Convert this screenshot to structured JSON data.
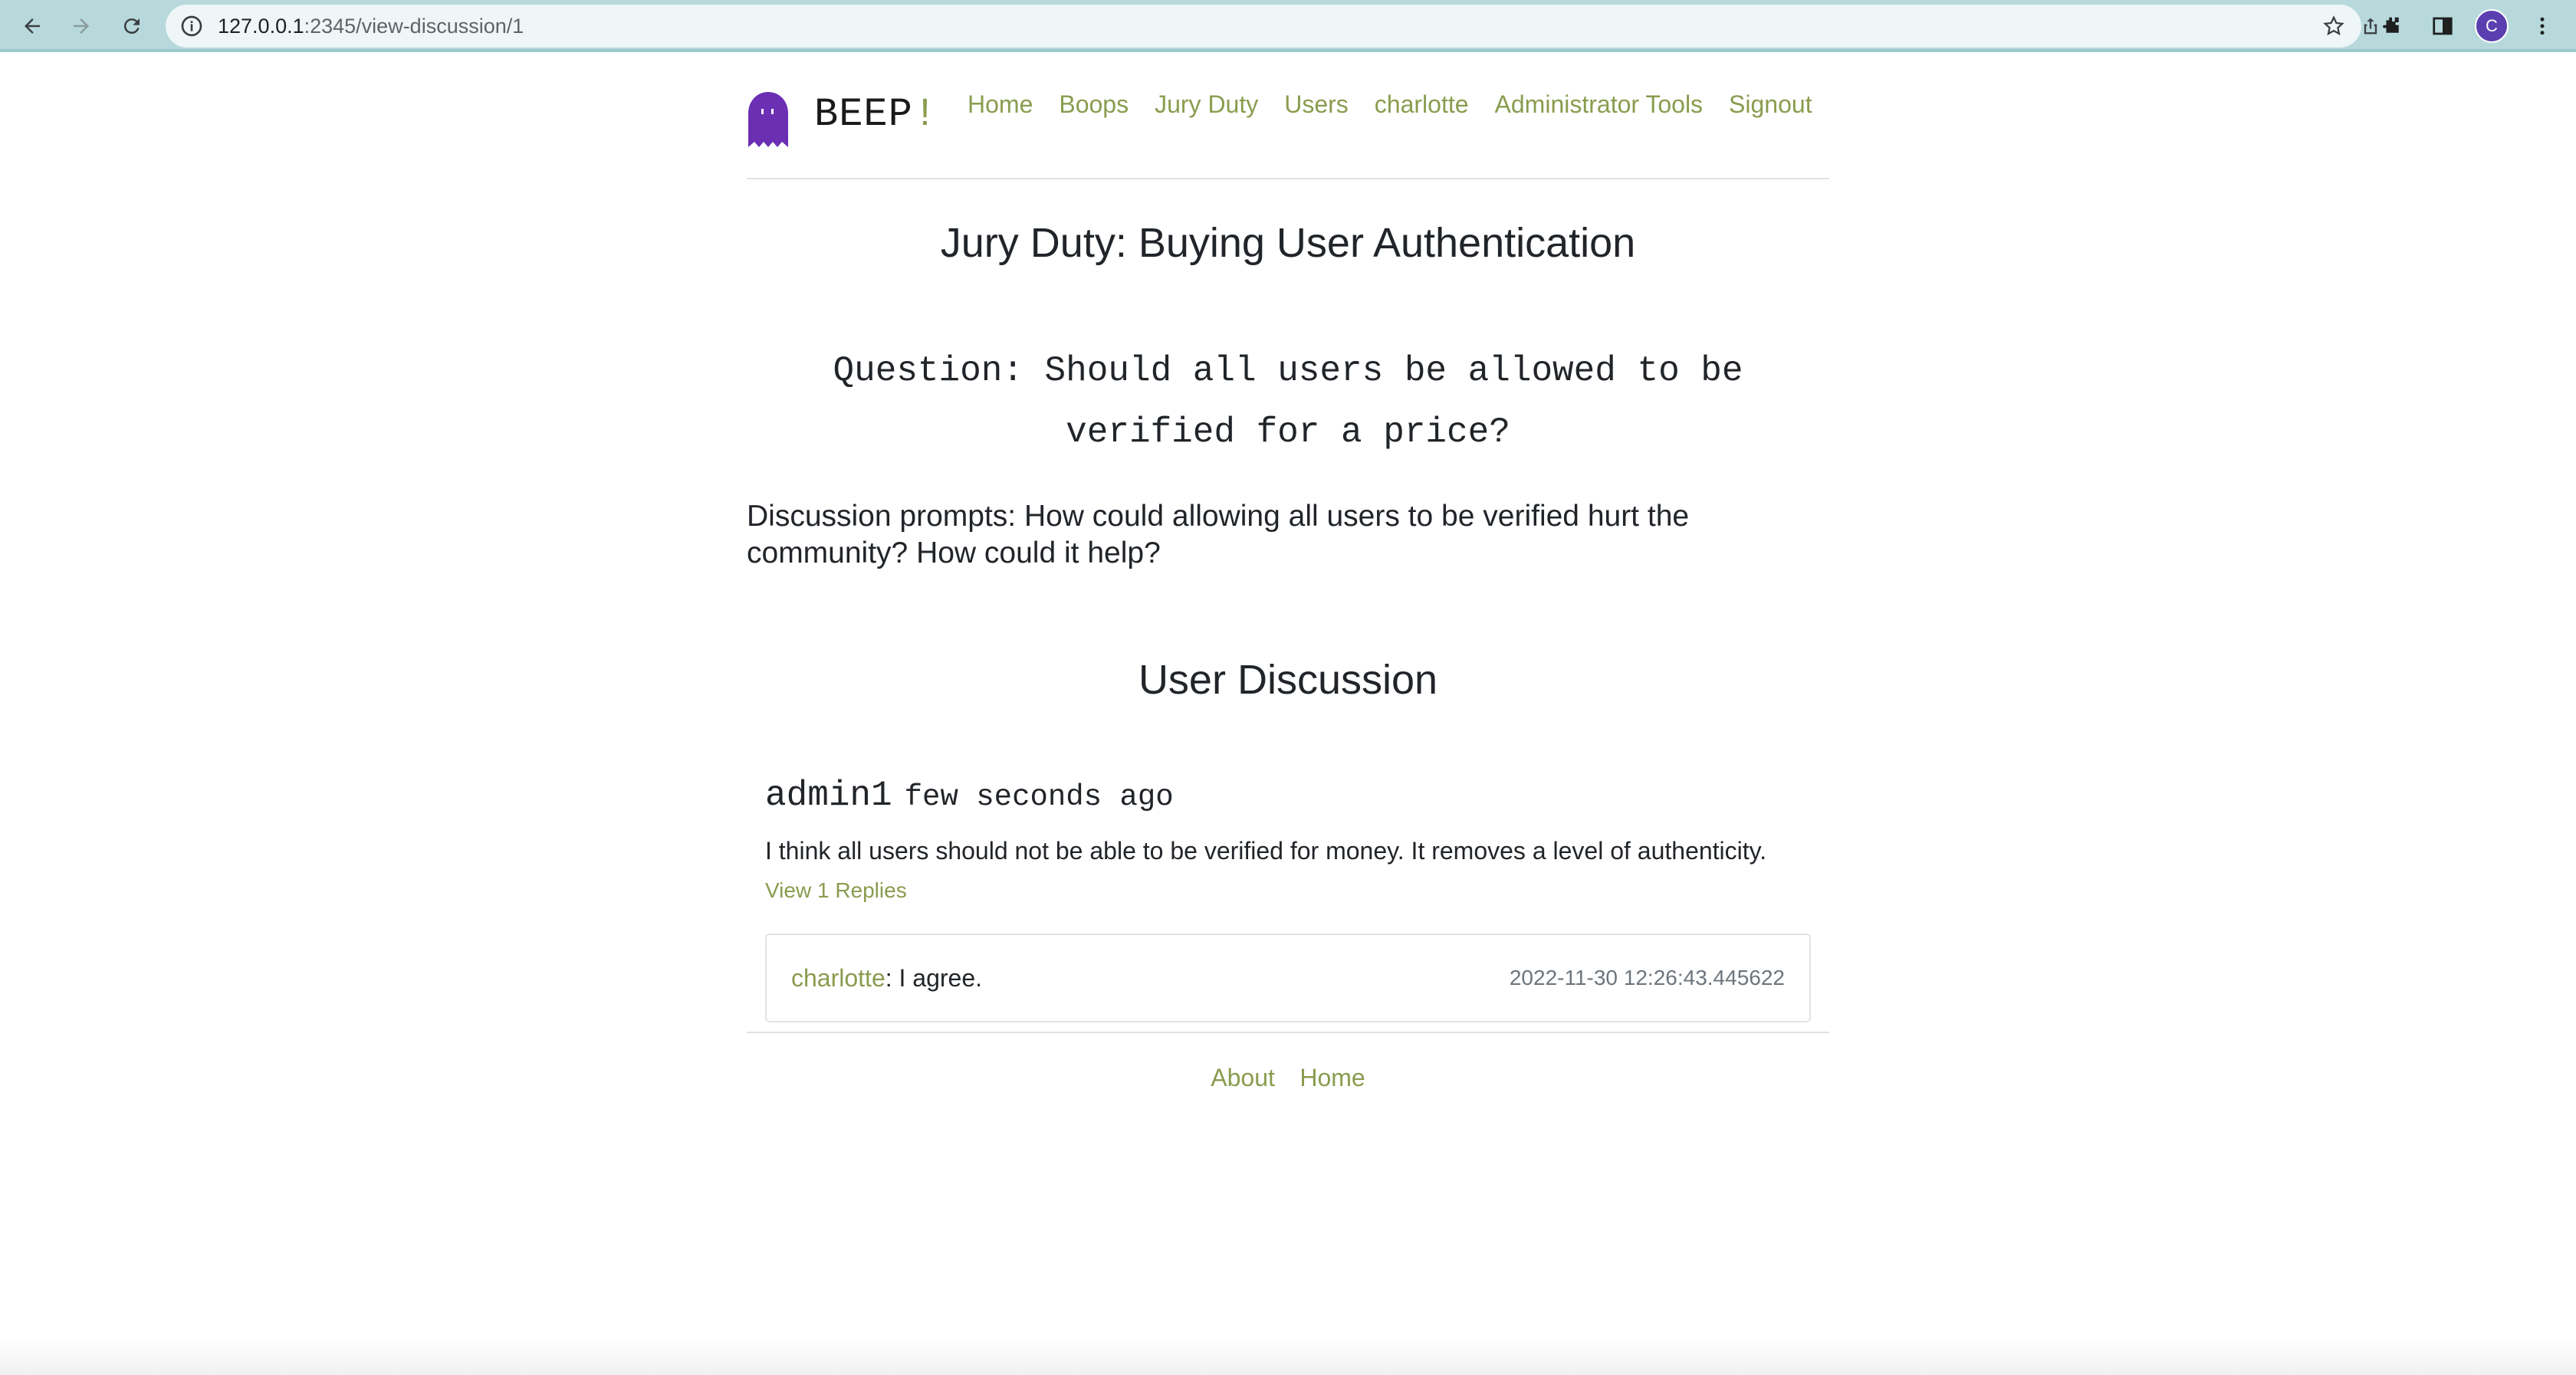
{
  "browser": {
    "url_host": "127.0.0.1",
    "url_rest": ":2345/view-discussion/1",
    "profile_initial": "C"
  },
  "site": {
    "brand": "BEEP",
    "brand_bang": "!",
    "nav": [
      "Home",
      "Boops",
      "Jury Duty",
      "Users",
      "charlotte",
      "Administrator Tools",
      "Signout"
    ]
  },
  "discussion": {
    "title": "Jury Duty: Buying User Authentication",
    "question": "Question: Should all users be allowed to be verified for a price?",
    "prompts": "Discussion prompts: How could allowing all users to be verified hurt the community? How could it help?",
    "section_title": "User Discussion"
  },
  "comment": {
    "author": "admin1",
    "time": "few seconds ago",
    "body": "I think all users should not be able to be verified for money. It removes a level of authenticity.",
    "view_replies": "View 1 Replies"
  },
  "reply": {
    "author": "charlotte",
    "text": ": I agree.",
    "timestamp": "2022-11-30 12:26:43.445622"
  },
  "footer": {
    "links": [
      "About",
      "Home"
    ]
  },
  "colors": {
    "accent": "#8a9c4e",
    "ghost": "#6b2fb3",
    "chrome": "#b7d9dc"
  }
}
